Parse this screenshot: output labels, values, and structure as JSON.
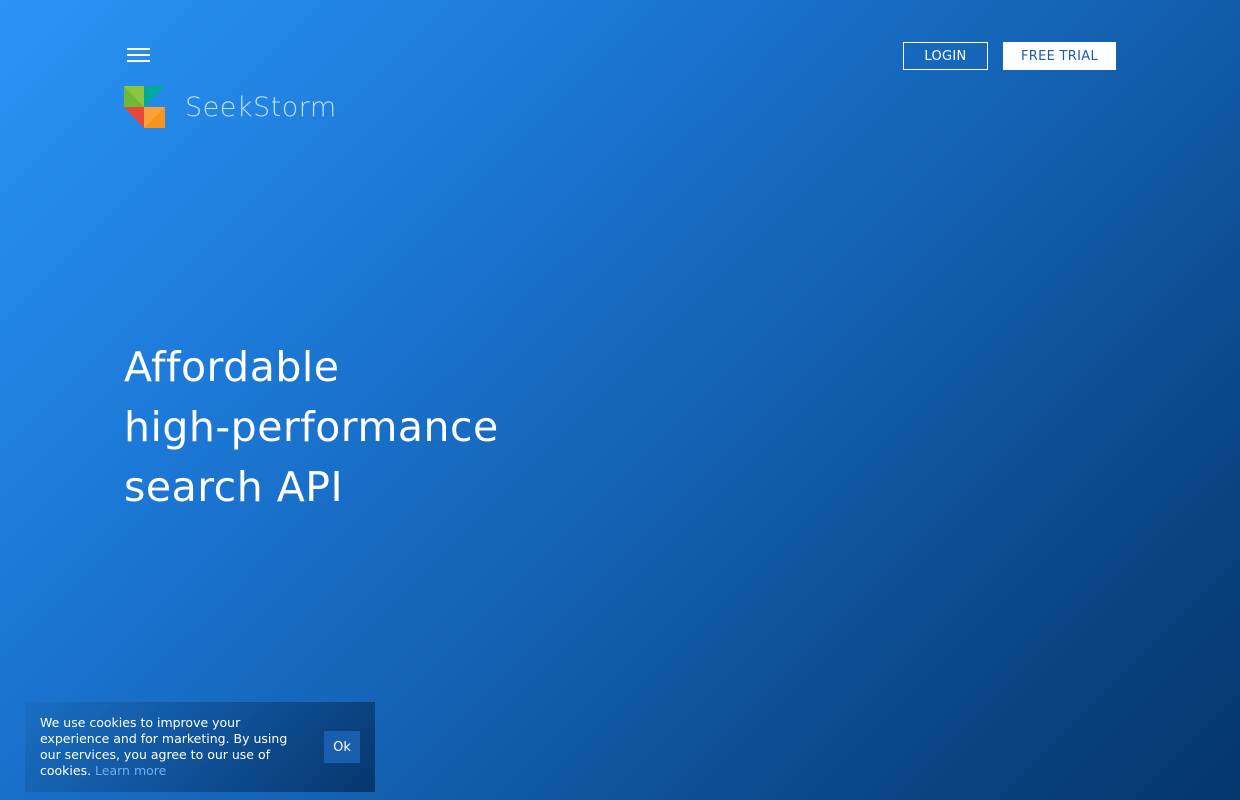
{
  "header": {
    "menu_icon": "hamburger-menu-icon",
    "login_label": "LOGIN",
    "trial_label": "FREE TRIAL"
  },
  "brand": {
    "name": "SeekStorm",
    "logo_icon": "seekstorm-logo-icon",
    "logo_colors": [
      "#8cc63f",
      "#00a99d",
      "#f7941d",
      "#e8463a"
    ],
    "text_color": "#bfe0ff"
  },
  "hero": {
    "line1": "Affordable",
    "line2": "high-performance",
    "line3": "search API"
  },
  "cookie_banner": {
    "text": "We use cookies to improve your experience and for marketing. By using our services, you agree to our use of cookies.",
    "link_label": "Learn more",
    "ok_label": "Ok"
  },
  "colors": {
    "background_start": "#2a95f5",
    "background_end": "#04366b",
    "trial_button_text": "#1a5ea6",
    "link": "#6fb0ee"
  }
}
